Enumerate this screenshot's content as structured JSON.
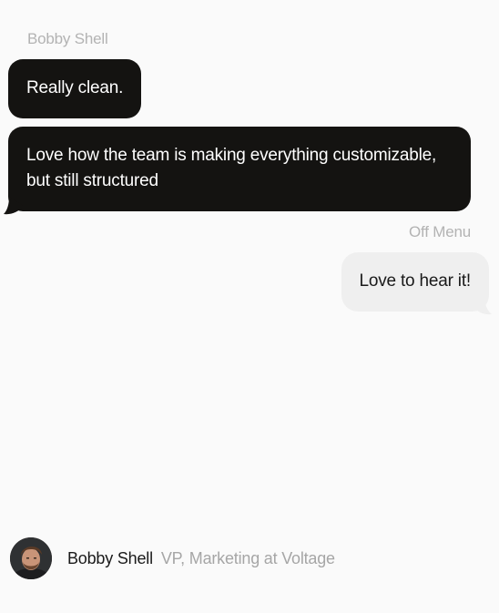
{
  "conversation": {
    "messages": [
      {
        "sender": "Bobby Shell",
        "text": "Really clean.",
        "style": "dark",
        "side": "left"
      },
      {
        "sender": "Bobby Shell",
        "text": "Love how the team is making everything customizable, but still structured",
        "style": "dark",
        "side": "left"
      },
      {
        "sender": "Off Menu",
        "text": "Love to hear it!",
        "style": "light",
        "side": "right"
      }
    ]
  },
  "footer": {
    "name": "Bobby Shell",
    "title": "VP, Marketing at Voltage"
  },
  "colors": {
    "background": "#fafafa",
    "dark_bubble": "#141311",
    "light_bubble": "#efefef",
    "muted_text": "#b3b3b3"
  }
}
